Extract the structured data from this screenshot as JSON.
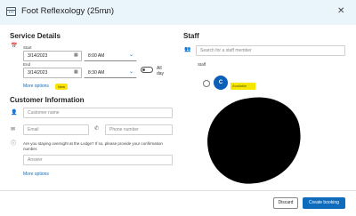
{
  "header": {
    "title": "Foot Reflexology (25mn)"
  },
  "service_details": {
    "heading": "Service Details",
    "start_label": "Start",
    "start_date": "3/14/2023",
    "start_time": "8:00 AM",
    "end_label": "End",
    "end_date": "3/14/2023",
    "end_time": "8:30 AM",
    "all_day_label": "All day",
    "more_options": "More options",
    "new_badge": "New"
  },
  "customer_information": {
    "heading": "Customer Information",
    "name_placeholder": "Customer name",
    "email_placeholder": "Email",
    "phone_placeholder": "Phone number",
    "question": "Are you staying overnight at the Lodge? If so, please provide your confirmation number.",
    "answer_placeholder": "Answer",
    "more_options": "More options"
  },
  "staff": {
    "heading": "Staff",
    "search_placeholder": "Search for a staff member",
    "list_label": "Staff",
    "member_initial": "C",
    "member_status": "Available"
  },
  "footer": {
    "discard_label": "Discard",
    "create_label": "Create booking"
  },
  "colors": {
    "header_bg": "#eaf4fb",
    "primary": "#0f6cbd",
    "avatar": "#0b5fb8",
    "highlight": "#f5e600",
    "badge": "#fde300"
  }
}
